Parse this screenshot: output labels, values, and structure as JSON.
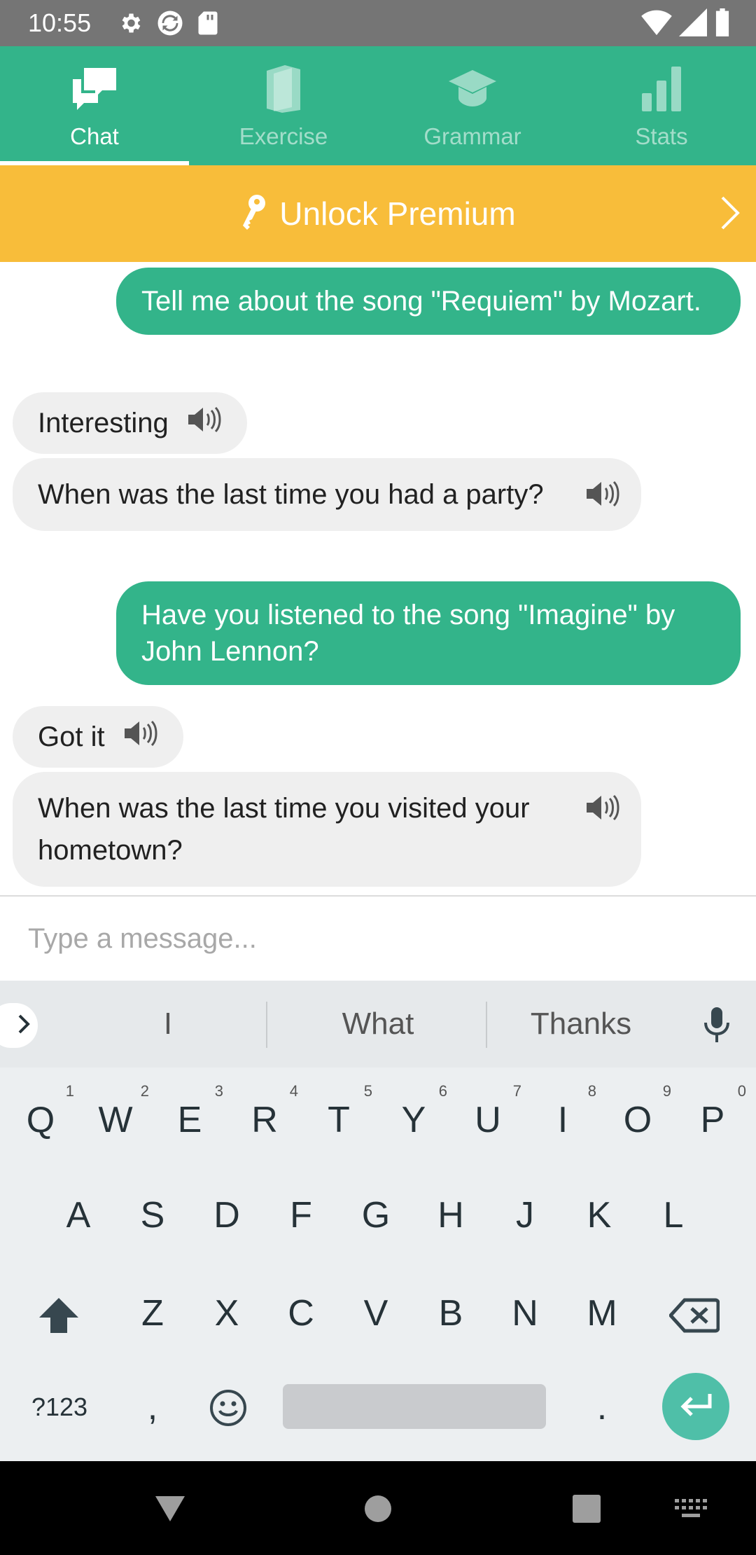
{
  "status_bar": {
    "time": "10:55",
    "icons": [
      "settings-icon",
      "sync-icon",
      "sd-card-icon",
      "wifi-icon",
      "signal-icon",
      "battery-icon"
    ]
  },
  "tabs": [
    {
      "label": "Chat",
      "icon": "chat-icon",
      "active": true
    },
    {
      "label": "Exercise",
      "icon": "book-icon",
      "active": false
    },
    {
      "label": "Grammar",
      "icon": "graduation-cap-icon",
      "active": false
    },
    {
      "label": "Stats",
      "icon": "bar-chart-icon",
      "active": false
    }
  ],
  "premium": {
    "label": "Unlock Premium",
    "icon": "key-icon"
  },
  "messages": [
    {
      "from": "user",
      "text": "Tell me about the song \"Requiem\" by Mozart."
    },
    {
      "from": "bot",
      "text": "Interesting"
    },
    {
      "from": "bot",
      "text": "When was the last time you had a party?"
    },
    {
      "from": "user",
      "text": "Have you listened to the song \"Imagine\" by John Lennon?"
    },
    {
      "from": "bot",
      "text": "Got it"
    },
    {
      "from": "bot",
      "text": "When was the last time you visited your hometown?"
    }
  ],
  "input": {
    "placeholder": "Type a message...",
    "value": ""
  },
  "keyboard": {
    "suggestions": [
      "I",
      "What",
      "Thanks"
    ],
    "row1": [
      "Q",
      "W",
      "E",
      "R",
      "T",
      "Y",
      "U",
      "I",
      "O",
      "P"
    ],
    "row1_hints": [
      "1",
      "2",
      "3",
      "4",
      "5",
      "6",
      "7",
      "8",
      "9",
      "0"
    ],
    "row2": [
      "A",
      "S",
      "D",
      "F",
      "G",
      "H",
      "J",
      "K",
      "L"
    ],
    "row3": [
      "Z",
      "X",
      "C",
      "V",
      "B",
      "N",
      "M"
    ],
    "symbols_key": "?123",
    "comma_key": ",",
    "period_key": "."
  },
  "colors": {
    "accent": "#33b48a",
    "premium": "#f8bd3a",
    "bot_bubble": "#efefef",
    "enter_key": "#4fbfa8"
  }
}
